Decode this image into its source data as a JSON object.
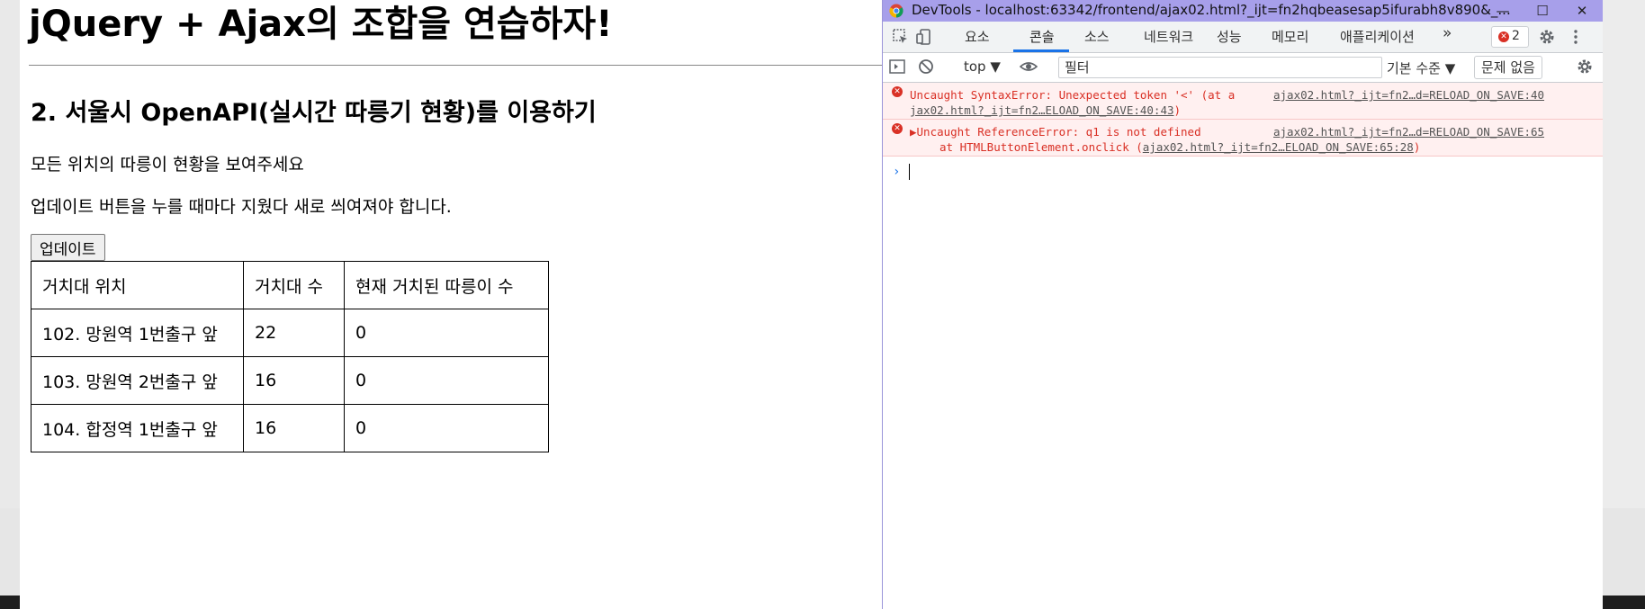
{
  "page": {
    "heading": "jQuery + Ajax의 조합을 연습하자!",
    "subheading": "2. 서울시 OpenAPI(실시간 따릉기 현황)를 이용하기",
    "desc1": "모든 위치의 따릉이 현황을 보여주세요",
    "desc2": "업데이트 버튼을 누를 때마다 지웠다 새로 씌여져야 합니다.",
    "update_button": "업데이트",
    "table": {
      "headers": [
        "거치대 위치",
        "거치대 수",
        "현재 거치된 따릉이 수"
      ],
      "rows": [
        [
          "102. 망원역 1번출구 앞",
          "22",
          "0"
        ],
        [
          "103. 망원역 2번출구 앞",
          "16",
          "0"
        ],
        [
          "104. 합정역 1번출구 앞",
          "16",
          "0"
        ]
      ]
    }
  },
  "devtools": {
    "title": "DevTools - localhost:63342/frontend/ajax02.html?_ijt=fn2hqbeasesap5ifurabh8v890&_...",
    "tabs": [
      "요소",
      "콘솔",
      "소스",
      "네트워크",
      "성능",
      "메모리",
      "애플리케이션"
    ],
    "active_tab": "콘솔",
    "more_tabs": "»",
    "error_count": "2",
    "context": "top ▼",
    "filter_placeholder": "필터",
    "log_level": "기본 수준 ▼",
    "issues": "문제 없음",
    "messages": [
      {
        "text": "Uncaught SyntaxError: Unexpected token '<' (at a",
        "source": "ajax02.html?_ijt=fn2…d=RELOAD_ON_SAVE:40",
        "cont": "jax02.html?_ijt=fn2…ELOAD_ON_SAVE:40:43",
        "cont_end": ")"
      },
      {
        "text": "▶Uncaught ReferenceError: q1 is not defined",
        "source": "ajax02.html?_ijt=fn2…d=RELOAD_ON_SAVE:65",
        "cont_prefix": "at HTMLButtonElement.onclick (",
        "cont": "ajax02.html?_ijt=fn2…ELOAD_ON_SAVE:65:28",
        "cont_end": ")"
      }
    ],
    "prompt": "›"
  },
  "colors": {
    "titlebar": "#a79fea",
    "error_red": "#d93025",
    "accent_blue": "#1a73e8",
    "error_bg": "#fff0f0"
  }
}
